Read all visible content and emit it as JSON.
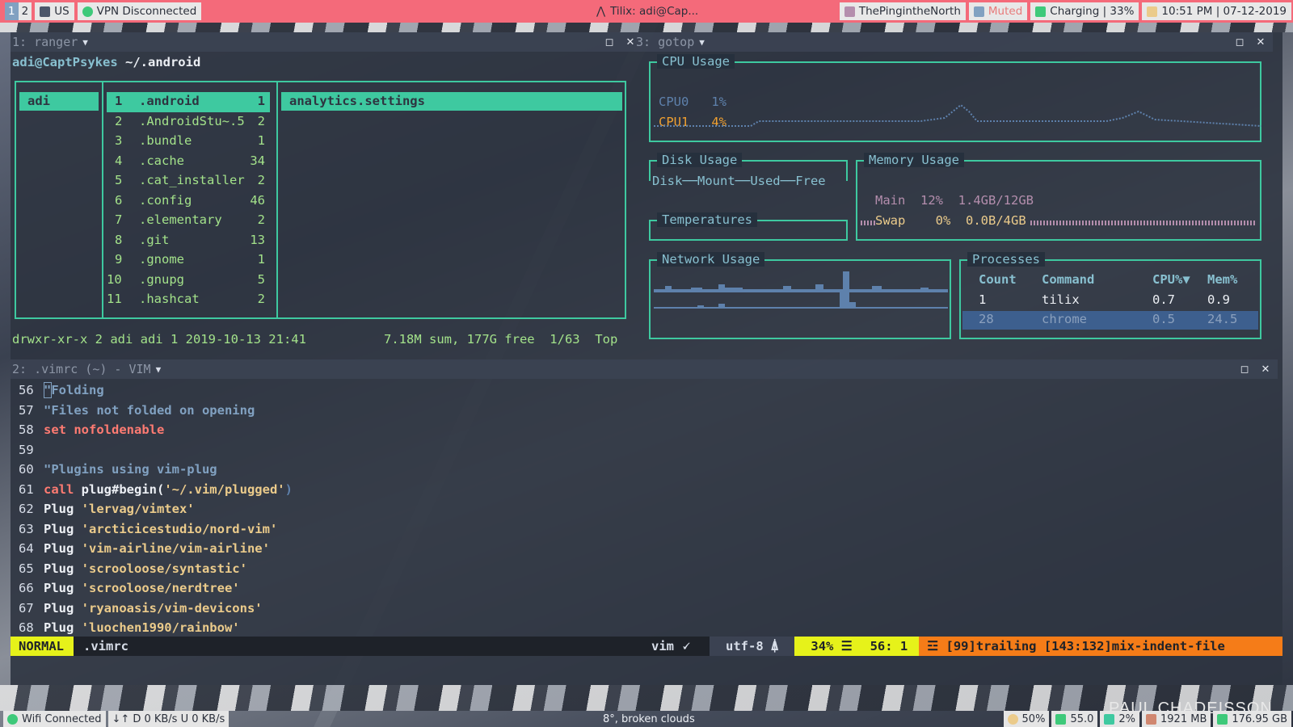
{
  "topbar": {
    "workspaces": [
      "1",
      "2"
    ],
    "keyboard": "US",
    "vpn": "VPN Disconnected",
    "window_title": "Tilix: adi@Cap...",
    "music": "ThePingintheNorth",
    "volume": "Muted",
    "battery": "Charging | 33%",
    "clock": "10:51 PM | 07-12-2019",
    "colors": {
      "bar": "#f46a7a",
      "workspace_active": "#81a1c1"
    }
  },
  "ranger": {
    "tab_title": "1: ranger",
    "prompt_user": "adi@CaptPsykes",
    "prompt_path": " ~/.android",
    "parent_dir": "adi",
    "entries": [
      {
        "n": "1",
        "name": ".android",
        "count": "1"
      },
      {
        "n": "2",
        "name": ".AndroidStu~.5",
        "count": "2"
      },
      {
        "n": "3",
        "name": ".bundle",
        "count": "1"
      },
      {
        "n": "4",
        "name": ".cache",
        "count": "34"
      },
      {
        "n": "5",
        "name": ".cat_installer",
        "count": "2"
      },
      {
        "n": "6",
        "name": ".config",
        "count": "46"
      },
      {
        "n": "7",
        "name": ".elementary",
        "count": "2"
      },
      {
        "n": "8",
        "name": ".git",
        "count": "13"
      },
      {
        "n": "9",
        "name": ".gnome",
        "count": "1"
      },
      {
        "n": "10",
        "name": ".gnupg",
        "count": "5"
      },
      {
        "n": "11",
        "name": ".hashcat",
        "count": "2"
      }
    ],
    "preview_item": "analytics.settings",
    "status_left": "drwxr-xr-x 2 adi adi 1 2019-10-13 21:41",
    "status_right": "7.18M sum, 177G free  1/63  Top"
  },
  "gotop": {
    "tab_title": "3: gotop",
    "cpu_title": "CPU Usage",
    "cpu": [
      {
        "name": "CPU0",
        "value": "1%"
      },
      {
        "name": "CPU1",
        "value": "4%"
      }
    ],
    "disk_title": "Disk Usage",
    "disk_headers": "Disk──Mount──Used──Free",
    "mem_title": "Memory Usage",
    "mem_main_label": "Main",
    "mem_main_pct": "12%",
    "mem_main_val": "1.4GB/12GB",
    "mem_swap_label": "Swap",
    "mem_swap_pct": "0%",
    "mem_swap_val": "0.0B/4GB",
    "temp_title": "Temperatures",
    "net_title": "Network Usage",
    "proc_title": "Processes",
    "proc_headers": [
      "Count",
      "Command",
      "CPU%▼",
      "Mem%"
    ],
    "processes": [
      {
        "count": "1",
        "cmd": "tilix",
        "cpu": "0.7",
        "mem": "0.9"
      },
      {
        "count": "28",
        "cmd": "chrome",
        "cpu": "0.5",
        "mem": "24.5"
      }
    ]
  },
  "vim": {
    "tab_title": "2: .vimrc (~) - VIM",
    "lines": [
      {
        "n": "56",
        "text": "\"Folding"
      },
      {
        "n": "57",
        "text": "\"Files not folded on opening"
      },
      {
        "n": "58",
        "kw": "set",
        "text": " nofoldenable"
      },
      {
        "n": "59",
        "text": ""
      },
      {
        "n": "60",
        "text": "\"Plugins using vim-plug"
      },
      {
        "n": "61",
        "kw": "call",
        "fn": " plug#begin(",
        "str": "'~/.vim/plugged'",
        "end": ")"
      },
      {
        "n": "62",
        "plug": "Plug",
        "str": " 'lervag/vimtex'"
      },
      {
        "n": "63",
        "plug": "Plug",
        "str": " 'arcticicestudio/nord-vim'"
      },
      {
        "n": "64",
        "plug": "Plug",
        "str": " 'vim-airline/vim-airline'"
      },
      {
        "n": "65",
        "plug": "Plug",
        "str": " 'scrooloose/syntastic'"
      },
      {
        "n": "66",
        "plug": "Plug",
        "str": " 'scrooloose/nerdtree'"
      },
      {
        "n": "67",
        "plug": "Plug",
        "str": " 'ryanoasis/vim-devicons'"
      },
      {
        "n": "68",
        "plug": "Plug",
        "str": " 'luochen1990/rainbow'"
      }
    ],
    "mode": "NORMAL",
    "filename": ".vimrc",
    "filetype": "vim",
    "encoding": "utf-8",
    "percent": "34%",
    "position": "56:  1",
    "warnings": "[99]trailing [143:132]mix-indent-file"
  },
  "bottombar": {
    "wifi": "Wifi Connected",
    "net_speed": "D 0 KB/s U 0 KB/s",
    "weather": "8°, broken clouds",
    "brightness": "50%",
    "temp": "55.0",
    "cpu": "2%",
    "mem": "1921 MB",
    "disk": "176.95 GB"
  }
}
